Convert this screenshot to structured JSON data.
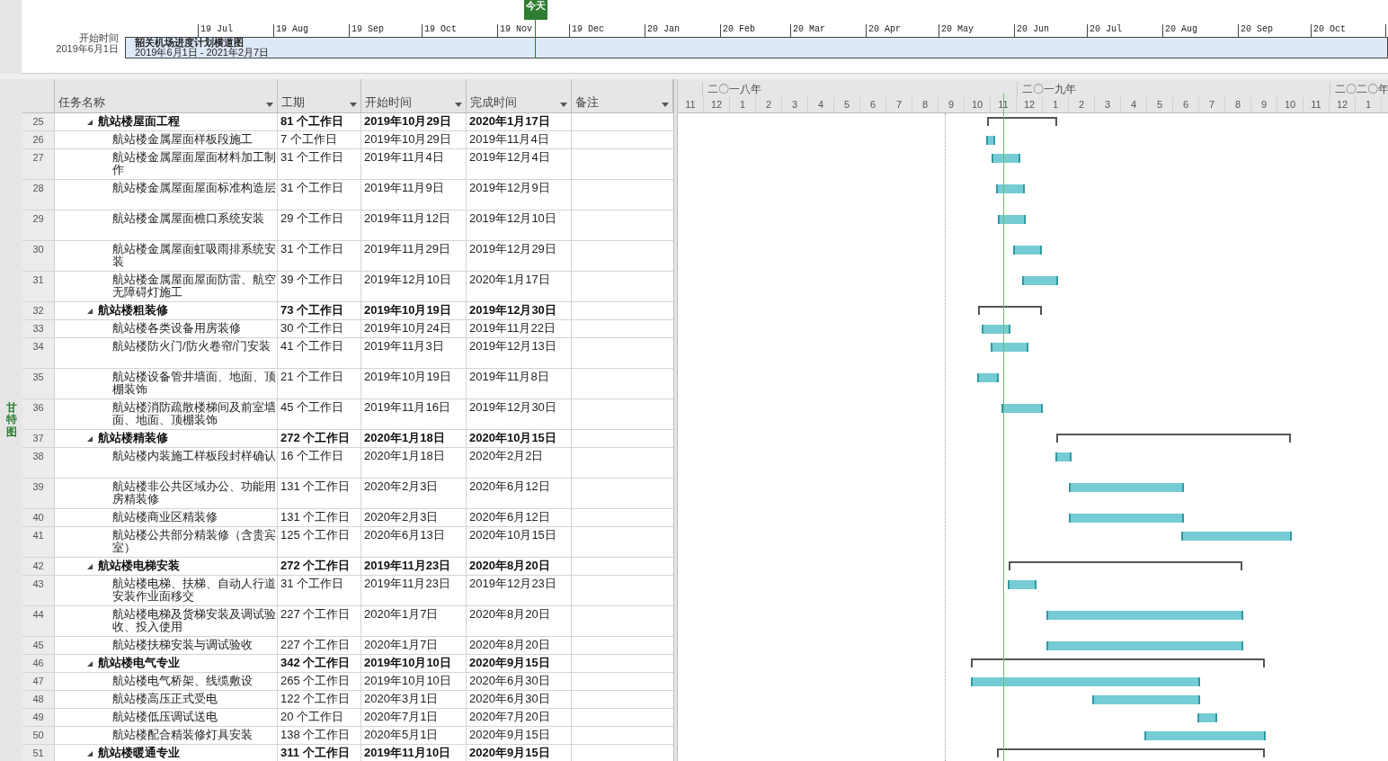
{
  "timeline": {
    "start_label": "开始时间",
    "start_date": "2019年6月1日",
    "title": "韶关机场进度计划横道图",
    "range": "2019年6月1日 - 2021年2月7日",
    "today_label": "今天",
    "months": [
      "19 Jul",
      "19 Aug",
      "19 Sep",
      "19 Oct",
      "19 Nov",
      "19 Dec",
      "20 Jan",
      "20 Feb",
      "20 Mar",
      "20 Apr",
      "20 May",
      "20 Jun",
      "20 Jul",
      "20 Aug",
      "20 Sep",
      "20 Oct"
    ]
  },
  "side_tab": {
    "label": "甘特图"
  },
  "table": {
    "columns": [
      "任务名称",
      "工期",
      "开始时间",
      "完成时间",
      "备注"
    ],
    "rows": [
      {
        "id": "25",
        "kind": "summary",
        "expanded": true,
        "name": "航站楼屋面工程",
        "duration": "81 个工作日",
        "start": "2019年10月29日",
        "finish": "2020年1月17日"
      },
      {
        "id": "26",
        "kind": "task",
        "name": "航站楼金属屋面样板段施工",
        "duration": "7 个工作日",
        "start": "2019年10月29日",
        "finish": "2019年11月4日"
      },
      {
        "id": "27",
        "kind": "task",
        "name": "航站楼金属屋面屋面材料加工制作",
        "duration": "31 个工作日",
        "start": "2019年11月4日",
        "finish": "2019年12月4日"
      },
      {
        "id": "28",
        "kind": "task",
        "name": "航站楼金属屋面屋面标准构造层",
        "duration": "31 个工作日",
        "start": "2019年11月9日",
        "finish": "2019年12月9日"
      },
      {
        "id": "29",
        "kind": "task",
        "name": "航站楼金属屋面檐口系统安装",
        "duration": "29 个工作日",
        "start": "2019年11月12日",
        "finish": "2019年12月10日"
      },
      {
        "id": "30",
        "kind": "task",
        "name": "航站楼金属屋面虹吸雨排系统安装",
        "duration": "31 个工作日",
        "start": "2019年11月29日",
        "finish": "2019年12月29日"
      },
      {
        "id": "31",
        "kind": "task",
        "name": "航站楼金属屋面屋面防雷、航空无障碍灯施工",
        "duration": "39 个工作日",
        "start": "2019年12月10日",
        "finish": "2020年1月17日"
      },
      {
        "id": "32",
        "kind": "summary",
        "expanded": true,
        "name": "航站楼粗装修",
        "duration": "73 个工作日",
        "start": "2019年10月19日",
        "finish": "2019年12月30日"
      },
      {
        "id": "33",
        "kind": "task",
        "name": "航站楼各类设备用房装修",
        "duration": "30 个工作日",
        "start": "2019年10月24日",
        "finish": "2019年11月22日"
      },
      {
        "id": "34",
        "kind": "task",
        "name": "航站楼防火门/防火卷帘/门安装",
        "duration": "41 个工作日",
        "start": "2019年11月3日",
        "finish": "2019年12月13日"
      },
      {
        "id": "35",
        "kind": "task",
        "name": "航站楼设备管井墙面、地面、顶棚装饰",
        "duration": "21 个工作日",
        "start": "2019年10月19日",
        "finish": "2019年11月8日"
      },
      {
        "id": "36",
        "kind": "task",
        "name": "航站楼消防疏散楼梯间及前室墙面、地面、顶棚装饰",
        "duration": "45 个工作日",
        "start": "2019年11月16日",
        "finish": "2019年12月30日"
      },
      {
        "id": "37",
        "kind": "summary",
        "expanded": true,
        "name": "航站楼精装修",
        "duration": "272 个工作日",
        "start": "2020年1月18日",
        "finish": "2020年10月15日"
      },
      {
        "id": "38",
        "kind": "task",
        "name": "航站楼内装施工样板段封样确认",
        "duration": "16 个工作日",
        "start": "2020年1月18日",
        "finish": "2020年2月2日"
      },
      {
        "id": "39",
        "kind": "task",
        "name": "航站楼非公共区域办公、功能用房精装修",
        "duration": "131 个工作日",
        "start": "2020年2月3日",
        "finish": "2020年6月12日"
      },
      {
        "id": "40",
        "kind": "task",
        "name": "航站楼商业区精装修",
        "duration": "131 个工作日",
        "start": "2020年2月3日",
        "finish": "2020年6月12日"
      },
      {
        "id": "41",
        "kind": "task",
        "name": "航站楼公共部分精装修（含贵宾室）",
        "duration": "125 个工作日",
        "start": "2020年6月13日",
        "finish": "2020年10月15日"
      },
      {
        "id": "42",
        "kind": "summary",
        "expanded": true,
        "name": "航站楼电梯安装",
        "duration": "272 个工作日",
        "start": "2019年11月23日",
        "finish": "2020年8月20日"
      },
      {
        "id": "43",
        "kind": "task",
        "name": "航站楼电梯、扶梯、自动人行道安装作业面移交",
        "duration": "31 个工作日",
        "start": "2019年11月23日",
        "finish": "2019年12月23日"
      },
      {
        "id": "44",
        "kind": "task",
        "name": "航站楼电梯及货梯安装及调试验收、投入使用",
        "duration": "227 个工作日",
        "start": "2020年1月7日",
        "finish": "2020年8月20日"
      },
      {
        "id": "45",
        "kind": "task",
        "name": "航站楼扶梯安装与调试验收",
        "duration": "227 个工作日",
        "start": "2020年1月7日",
        "finish": "2020年8月20日"
      },
      {
        "id": "46",
        "kind": "summary",
        "expanded": true,
        "name": "航站楼电气专业",
        "duration": "342 个工作日",
        "start": "2019年10月10日",
        "finish": "2020年9月15日"
      },
      {
        "id": "47",
        "kind": "task",
        "name": "航站楼电气桥架、线缆敷设",
        "duration": "265 个工作日",
        "start": "2019年10月10日",
        "finish": "2020年6月30日"
      },
      {
        "id": "48",
        "kind": "task",
        "name": "航站楼高压正式受电",
        "duration": "122 个工作日",
        "start": "2020年3月1日",
        "finish": "2020年6月30日"
      },
      {
        "id": "49",
        "kind": "task",
        "name": "航站楼低压调试送电",
        "duration": "20 个工作日",
        "start": "2020年7月1日",
        "finish": "2020年7月20日"
      },
      {
        "id": "50",
        "kind": "task",
        "name": "航站楼配合精装修灯具安装",
        "duration": "138 个工作日",
        "start": "2020年5月1日",
        "finish": "2020年9月15日"
      },
      {
        "id": "51",
        "kind": "summary",
        "expanded": true,
        "name": "航站楼暖通专业",
        "duration": "311 个工作日",
        "start": "2019年11月10日",
        "finish": "2020年9月15日"
      }
    ]
  },
  "gantt_header": {
    "years": [
      "二〇一八年",
      "二〇一九年",
      "二〇二〇年"
    ],
    "months": [
      "11",
      "12",
      "1",
      "2",
      "3",
      "4",
      "5",
      "6",
      "7",
      "8",
      "9",
      "10",
      "11",
      "12",
      "1",
      "2",
      "3",
      "4",
      "5",
      "6",
      "7",
      "8",
      "9",
      "10",
      "11",
      "12",
      "1"
    ]
  }
}
